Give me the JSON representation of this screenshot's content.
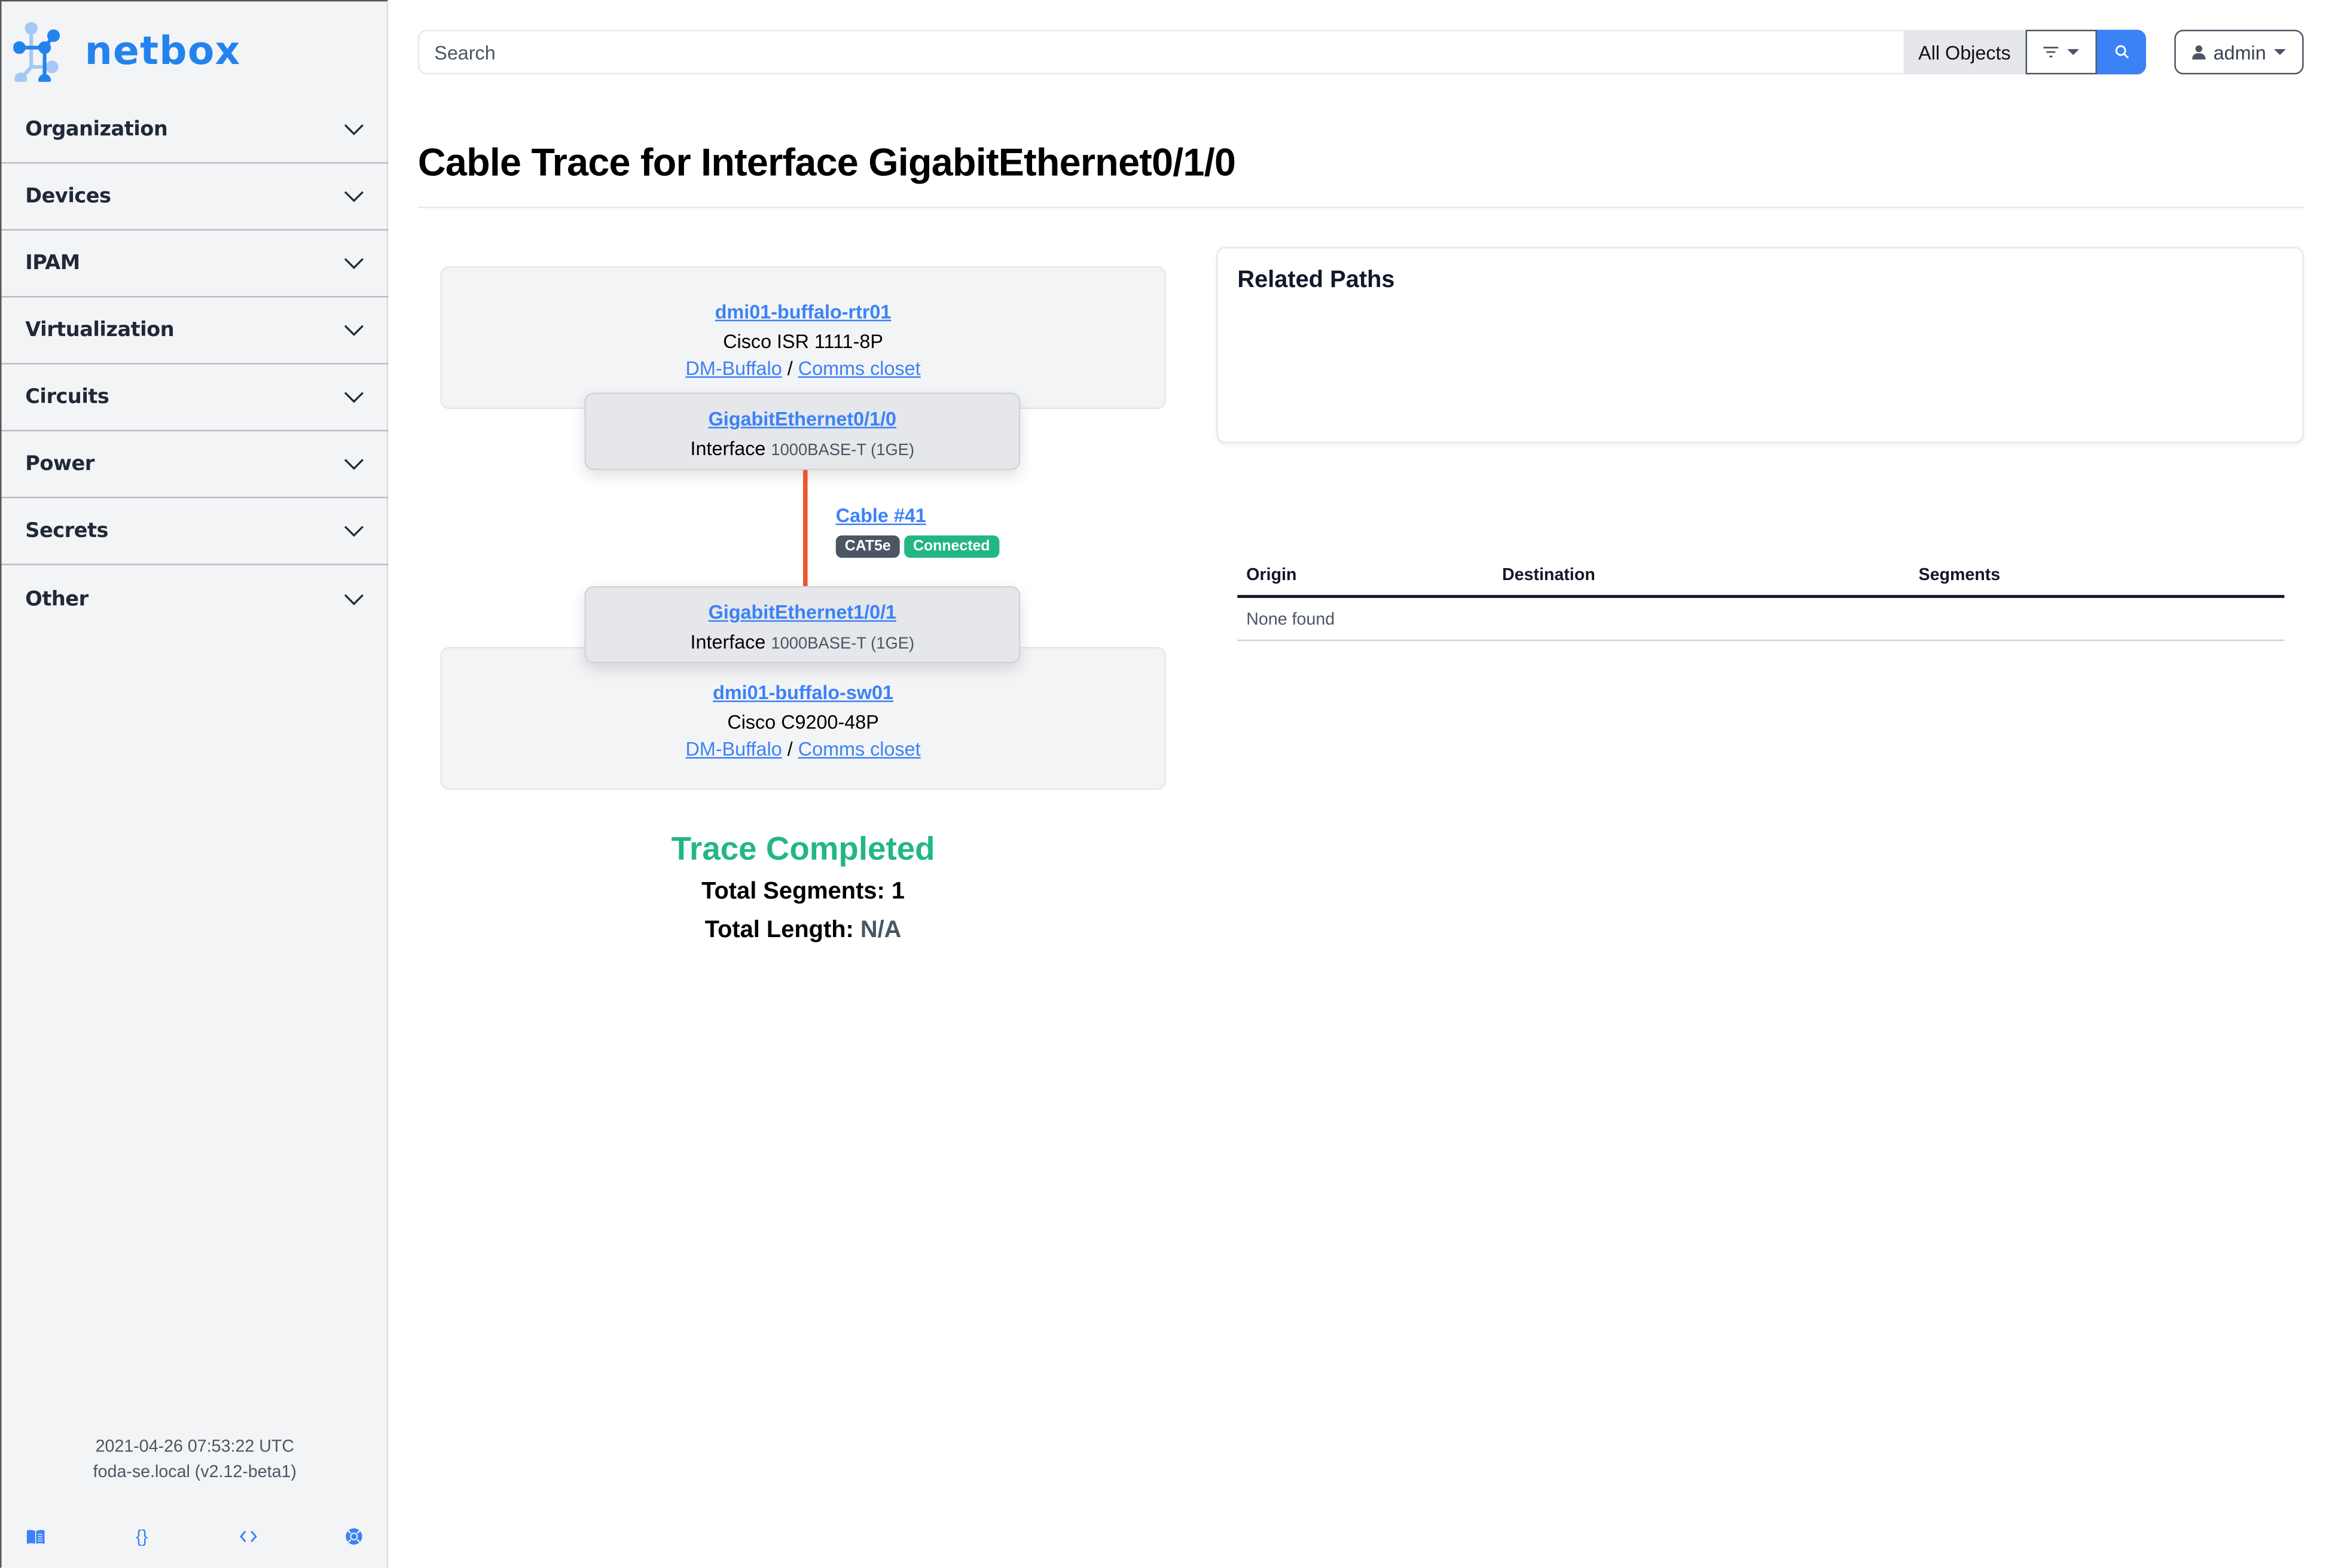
{
  "brand": {
    "name": "netbox",
    "color": "#2383ee"
  },
  "sidebar": {
    "items": [
      {
        "label": "Organization"
      },
      {
        "label": "Devices"
      },
      {
        "label": "IPAM"
      },
      {
        "label": "Virtualization"
      },
      {
        "label": "Circuits"
      },
      {
        "label": "Power"
      },
      {
        "label": "Secrets"
      },
      {
        "label": "Other"
      }
    ],
    "footer": {
      "timestamp": "2021-04-26 07:53:22 UTC",
      "host": "foda-se.local (v2.12-beta1)"
    },
    "footer_icons": [
      "book-icon",
      "braces-icon",
      "code-icon",
      "lifebuoy-icon"
    ]
  },
  "topbar": {
    "search_placeholder": "Search",
    "search_value": "",
    "scope_label": "All Objects",
    "filter_icon": "filter-icon",
    "search_icon": "search-icon",
    "user_label": "admin",
    "accent": "#3b82f6"
  },
  "page": {
    "title": "Cable Trace for Interface GigabitEthernet0/1/0"
  },
  "trace": {
    "origin_device": {
      "name": "dmi01-buffalo-rtr01",
      "type": "Cisco ISR 1111-8P",
      "site": "DM-Buffalo",
      "separator": "/",
      "location": "Comms closet"
    },
    "origin_interface": {
      "name": "GigabitEthernet0/1/0",
      "kind": "Interface",
      "type": "1000BASE-T (1GE)"
    },
    "cable": {
      "label": "Cable #41",
      "color": "#f0522c",
      "badges": [
        {
          "text": "CAT5e",
          "color": "#4b5563"
        },
        {
          "text": "Connected",
          "color": "#22b783"
        }
      ]
    },
    "destination_interface": {
      "name": "GigabitEthernet1/0/1",
      "kind": "Interface",
      "type": "1000BASE-T (1GE)"
    },
    "destination_device": {
      "name": "dmi01-buffalo-sw01",
      "type": "Cisco C9200-48P",
      "site": "DM-Buffalo",
      "separator": "/",
      "location": "Comms closet"
    },
    "status": "Trace Completed",
    "status_color": "#22b783",
    "total_segments_label": "Total Segments:",
    "total_segments": "1",
    "total_length_label": "Total Length:",
    "total_length": "N/A"
  },
  "related_paths": {
    "title": "Related Paths",
    "columns": [
      "Origin",
      "Destination",
      "Segments"
    ],
    "empty_text": "None found"
  }
}
